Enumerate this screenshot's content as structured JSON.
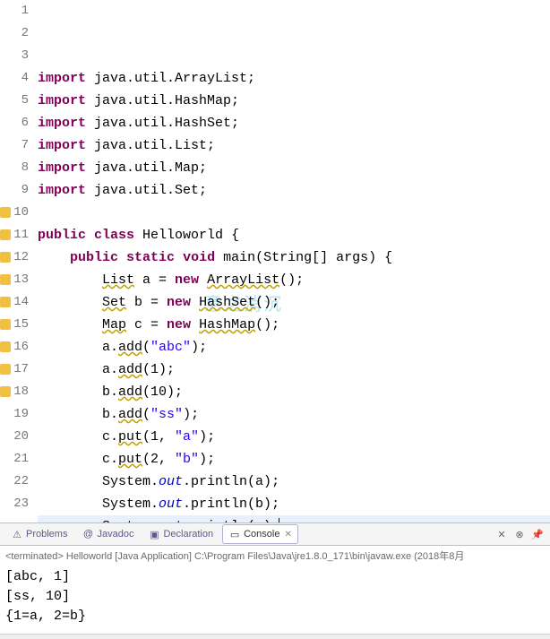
{
  "watermark": "意之消沉",
  "code": {
    "lines": [
      {
        "n": 1,
        "warn": false,
        "tokens": [
          {
            "t": "kw",
            "s": "import"
          },
          {
            "t": "norm",
            "s": " java.util.ArrayList;"
          }
        ]
      },
      {
        "n": 2,
        "warn": false,
        "tokens": [
          {
            "t": "kw",
            "s": "import"
          },
          {
            "t": "norm",
            "s": " java.util.HashMap;"
          }
        ]
      },
      {
        "n": 3,
        "warn": false,
        "tokens": [
          {
            "t": "kw",
            "s": "import"
          },
          {
            "t": "norm",
            "s": " java.util.HashSet;"
          }
        ]
      },
      {
        "n": 4,
        "warn": false,
        "tokens": [
          {
            "t": "kw",
            "s": "import"
          },
          {
            "t": "norm",
            "s": " java.util.List;"
          }
        ]
      },
      {
        "n": 5,
        "warn": false,
        "tokens": [
          {
            "t": "kw",
            "s": "import"
          },
          {
            "t": "norm",
            "s": " java.util.Map;"
          }
        ]
      },
      {
        "n": 6,
        "warn": false,
        "tokens": [
          {
            "t": "kw",
            "s": "import"
          },
          {
            "t": "norm",
            "s": " java.util.Set;"
          }
        ]
      },
      {
        "n": 7,
        "warn": false,
        "tokens": []
      },
      {
        "n": 8,
        "warn": false,
        "tokens": [
          {
            "t": "kw",
            "s": "public"
          },
          {
            "t": "norm",
            "s": " "
          },
          {
            "t": "kw",
            "s": "class"
          },
          {
            "t": "norm",
            "s": " Helloworld {"
          }
        ]
      },
      {
        "n": 9,
        "warn": false,
        "tokens": [
          {
            "t": "norm",
            "s": "    "
          },
          {
            "t": "kw",
            "s": "public"
          },
          {
            "t": "norm",
            "s": " "
          },
          {
            "t": "kw",
            "s": "static"
          },
          {
            "t": "norm",
            "s": " "
          },
          {
            "t": "kw",
            "s": "void"
          },
          {
            "t": "norm",
            "s": " main(String[] args) {"
          }
        ]
      },
      {
        "n": 10,
        "warn": true,
        "tokens": [
          {
            "t": "norm",
            "s": "        "
          },
          {
            "t": "raw",
            "s": "List",
            "wavy": true
          },
          {
            "t": "norm",
            "s": " a = "
          },
          {
            "t": "kw",
            "s": "new"
          },
          {
            "t": "norm",
            "s": " "
          },
          {
            "t": "raw",
            "s": "ArrayList",
            "wavy": true
          },
          {
            "t": "norm",
            "s": "();"
          }
        ]
      },
      {
        "n": 11,
        "warn": true,
        "tokens": [
          {
            "t": "norm",
            "s": "        "
          },
          {
            "t": "raw",
            "s": "Set",
            "wavy": true
          },
          {
            "t": "norm",
            "s": " b = "
          },
          {
            "t": "kw",
            "s": "new"
          },
          {
            "t": "norm",
            "s": " "
          },
          {
            "t": "raw",
            "s": "HashSet",
            "wavy": true
          },
          {
            "t": "norm",
            "s": "();"
          }
        ]
      },
      {
        "n": 12,
        "warn": true,
        "tokens": [
          {
            "t": "norm",
            "s": "        "
          },
          {
            "t": "raw",
            "s": "Map",
            "wavy": true
          },
          {
            "t": "norm",
            "s": " c = "
          },
          {
            "t": "kw",
            "s": "new"
          },
          {
            "t": "norm",
            "s": " "
          },
          {
            "t": "raw",
            "s": "HashMap",
            "wavy": true
          },
          {
            "t": "norm",
            "s": "();"
          }
        ]
      },
      {
        "n": 13,
        "warn": true,
        "tokens": [
          {
            "t": "norm",
            "s": "        a."
          },
          {
            "t": "raw",
            "s": "add",
            "wavy": true
          },
          {
            "t": "norm",
            "s": "("
          },
          {
            "t": "str",
            "s": "\"abc\""
          },
          {
            "t": "norm",
            "s": ");"
          }
        ]
      },
      {
        "n": 14,
        "warn": true,
        "tokens": [
          {
            "t": "norm",
            "s": "        a."
          },
          {
            "t": "raw",
            "s": "add",
            "wavy": true
          },
          {
            "t": "norm",
            "s": "(1);"
          }
        ]
      },
      {
        "n": 15,
        "warn": true,
        "tokens": [
          {
            "t": "norm",
            "s": "        b."
          },
          {
            "t": "raw",
            "s": "add",
            "wavy": true
          },
          {
            "t": "norm",
            "s": "(10);"
          }
        ]
      },
      {
        "n": 16,
        "warn": true,
        "tokens": [
          {
            "t": "norm",
            "s": "        b."
          },
          {
            "t": "raw",
            "s": "add",
            "wavy": true
          },
          {
            "t": "norm",
            "s": "("
          },
          {
            "t": "str",
            "s": "\"ss\""
          },
          {
            "t": "norm",
            "s": ");"
          }
        ]
      },
      {
        "n": 17,
        "warn": true,
        "tokens": [
          {
            "t": "norm",
            "s": "        c."
          },
          {
            "t": "raw",
            "s": "put",
            "wavy": true
          },
          {
            "t": "norm",
            "s": "(1, "
          },
          {
            "t": "str",
            "s": "\"a\""
          },
          {
            "t": "norm",
            "s": ");"
          }
        ]
      },
      {
        "n": 18,
        "warn": true,
        "tokens": [
          {
            "t": "norm",
            "s": "        c."
          },
          {
            "t": "raw",
            "s": "put",
            "wavy": true
          },
          {
            "t": "norm",
            "s": "(2, "
          },
          {
            "t": "str",
            "s": "\"b\""
          },
          {
            "t": "norm",
            "s": ");"
          }
        ]
      },
      {
        "n": 19,
        "warn": false,
        "tokens": [
          {
            "t": "norm",
            "s": "        System."
          },
          {
            "t": "field",
            "s": "out"
          },
          {
            "t": "norm",
            "s": ".println(a);"
          }
        ]
      },
      {
        "n": 20,
        "warn": false,
        "tokens": [
          {
            "t": "norm",
            "s": "        System."
          },
          {
            "t": "field",
            "s": "out"
          },
          {
            "t": "norm",
            "s": ".println(b);"
          }
        ]
      },
      {
        "n": 21,
        "warn": false,
        "hl": true,
        "cursor": true,
        "tokens": [
          {
            "t": "norm",
            "s": "        System."
          },
          {
            "t": "field",
            "s": "out"
          },
          {
            "t": "norm",
            "s": ".println(c);"
          }
        ]
      },
      {
        "n": 22,
        "warn": false,
        "tokens": [
          {
            "t": "norm",
            "s": "    }"
          }
        ]
      },
      {
        "n": 23,
        "warn": false,
        "tokens": [
          {
            "t": "norm",
            "s": "}"
          }
        ]
      }
    ]
  },
  "tabs": {
    "items": [
      {
        "icon": "problems-icon",
        "label": "Problems",
        "active": false
      },
      {
        "icon": "javadoc-icon",
        "label": "Javadoc",
        "active": false
      },
      {
        "icon": "declaration-icon",
        "label": "Declaration",
        "active": false
      },
      {
        "icon": "console-icon",
        "label": "Console",
        "active": true
      }
    ],
    "toolbar": [
      {
        "name": "remove-launch-icon",
        "glyph": "✕"
      },
      {
        "name": "remove-all-icon",
        "glyph": "⊗"
      },
      {
        "name": "pin-icon",
        "glyph": "📌"
      }
    ]
  },
  "console": {
    "terminated": "<terminated> Helloworld [Java Application] C:\\Program Files\\Java\\jre1.8.0_171\\bin\\javaw.exe (2018年8月",
    "output": [
      "[abc, 1]",
      "[ss, 10]",
      "{1=a, 2=b}"
    ]
  }
}
